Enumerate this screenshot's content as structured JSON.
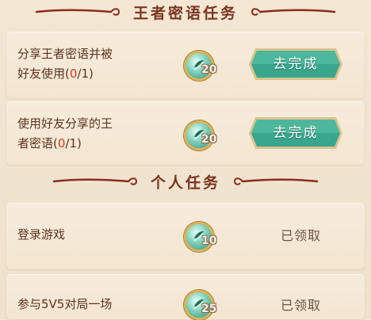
{
  "sections": {
    "secret": {
      "title": "王者密语任务"
    },
    "personal": {
      "title": "个人任务"
    }
  },
  "tasks": [
    {
      "line1": "分享王者密语并被",
      "line2_pre": "好友使用(",
      "progress": "0",
      "line2_post": "/1)",
      "reward": "20",
      "action": "去完成"
    },
    {
      "line1": "使用好友分享的王",
      "line2_pre": "者密语(",
      "progress": "0",
      "line2_post": "/1)",
      "reward": "20",
      "action": "去完成"
    },
    {
      "label": "登录游戏",
      "reward": "10",
      "status": "已领取"
    },
    {
      "label": "参与5V5对局一场",
      "reward": "25",
      "status": "已领取"
    }
  ],
  "colors": {
    "button_teal": "#3aa68d",
    "button_border": "#e9d7a3",
    "progress_red": "#d63b26",
    "title_brown": "#7a3520"
  }
}
